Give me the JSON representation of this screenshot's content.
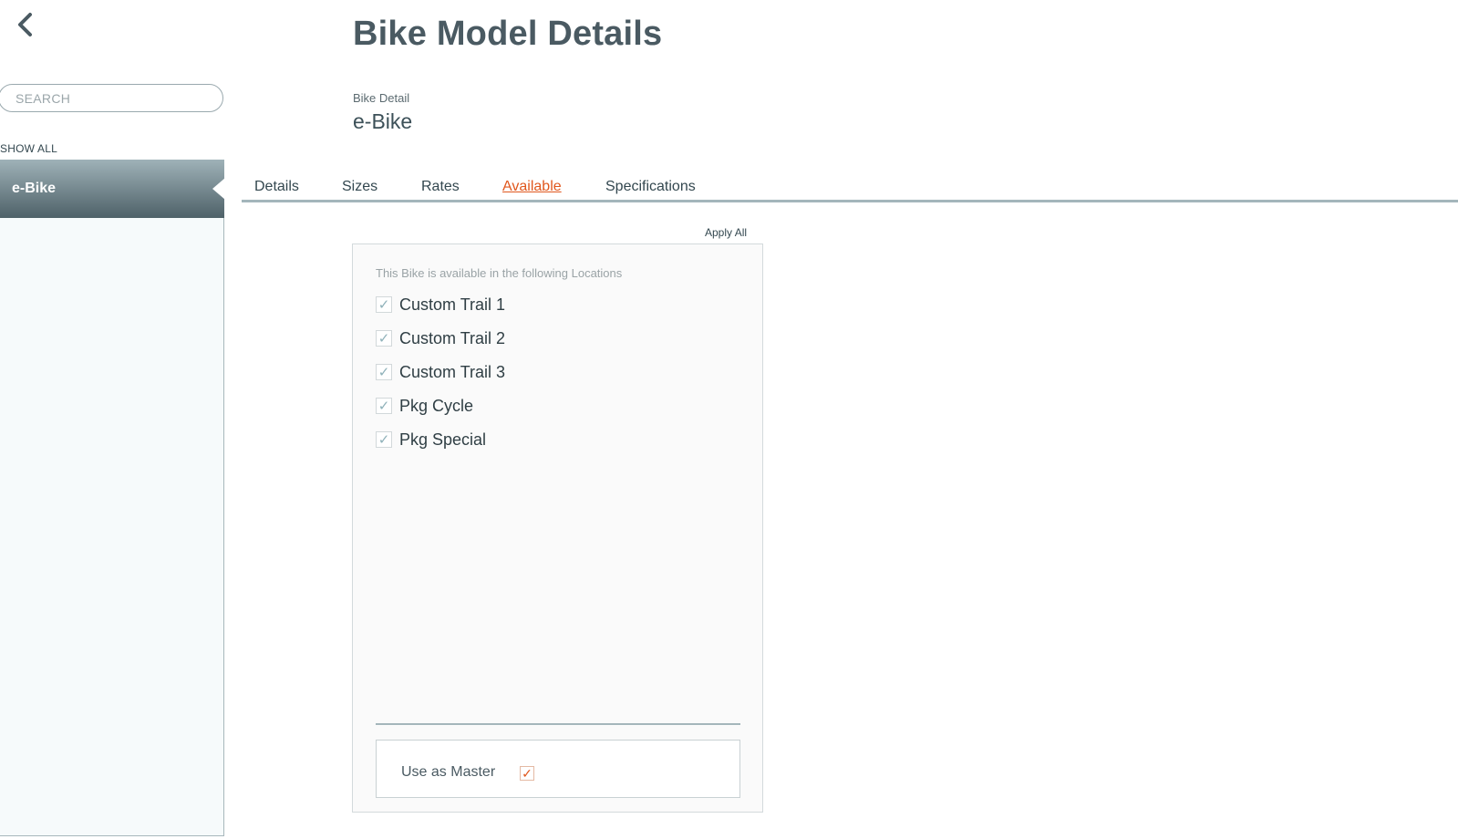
{
  "sidebar": {
    "search_placeholder": "SEARCH",
    "show_all_label": "SHOW ALL",
    "items": [
      {
        "label": "e-Bike",
        "active": true
      }
    ]
  },
  "header": {
    "title": "Bike Model Details",
    "detail_label": "Bike Detail",
    "detail_value": "e-Bike"
  },
  "tabs": [
    {
      "label": "Details",
      "active": false
    },
    {
      "label": "Sizes",
      "active": false
    },
    {
      "label": "Rates",
      "active": false
    },
    {
      "label": "Available",
      "active": true
    },
    {
      "label": "Specifications",
      "active": false
    }
  ],
  "availability": {
    "apply_all_label": "Apply All",
    "note": "This Bike is available in the following Locations",
    "check_glyph": "✓",
    "locations": [
      {
        "label": "Custom Trail 1",
        "checked": true
      },
      {
        "label": "Custom Trail 2",
        "checked": true
      },
      {
        "label": "Custom Trail 3",
        "checked": true
      },
      {
        "label": "Pkg Cycle",
        "checked": true
      },
      {
        "label": "Pkg Special",
        "checked": true
      }
    ],
    "use_as_master_label": "Use as Master",
    "use_as_master_checked": true
  },
  "colors": {
    "accent": "#e0571d",
    "text": "#33474f",
    "sidebar_active_top": "#9fb2b8",
    "sidebar_active_bottom": "#4e6168",
    "tab_rule": "#a4b6bb",
    "check": "#8fb1b9"
  },
  "icons": {
    "back": "chevron-left-icon",
    "check": "check-icon"
  }
}
